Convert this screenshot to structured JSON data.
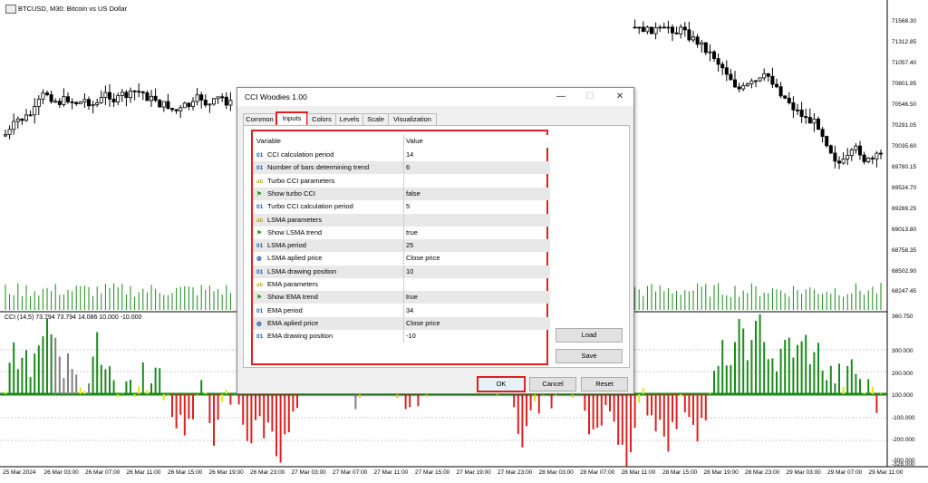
{
  "chart": {
    "title": "BTCUSD, M30:  Bitcoin vs US Dollar",
    "indicator_label": "CCI (14,5) 73.794 73.794 14.086 10.000 -10.000",
    "price_labels": [
      "71568.30",
      "71312.85",
      "71057.40",
      "70801.95",
      "70546.50",
      "70291.05",
      "70035.60",
      "69780.15",
      "69524.70",
      "69269.25",
      "69013.80",
      "68758.35",
      "68502.90",
      "68247.45",
      "360.750",
      "300.000",
      "200.000",
      "100.000",
      "-100.000",
      "-200.000",
      "-300.000",
      "-328.000"
    ],
    "time_labels": [
      "25 Mar 2024",
      "26 Mar 03:00",
      "26 Mar 07:00",
      "26 Mar 11:00",
      "26 Mar 15:00",
      "26 Mar 19:00",
      "26 Mar 23:00",
      "27 Mar 03:00",
      "27 Mar 07:00",
      "27 Mar 11:00",
      "27 Mar 15:00",
      "27 Mar 19:00",
      "27 Mar 23:00",
      "28 Mar 03:00",
      "28 Mar 07:00",
      "28 Mar 11:00",
      "28 Mar 15:00",
      "28 Mar 19:00",
      "28 Mar 23:00",
      "29 Mar 03:00",
      "29 Mar 07:00",
      "29 Mar 11:00"
    ],
    "colors": {
      "up": "#1a8a1a",
      "down": "#e02020",
      "neutral": "#808080",
      "flat": "#e6e600"
    }
  },
  "dialog": {
    "title": "CCI Woodies 1.00",
    "minimize": "—",
    "maximize": "☐",
    "close": "✕",
    "tabs": [
      "Common",
      "Inputs",
      "Colors",
      "Levels",
      "Scale",
      "Visualization"
    ],
    "active_tab": "Inputs",
    "columns": {
      "variable": "Variable",
      "value": "Value"
    },
    "params": [
      {
        "icon": "01",
        "name": "CCI calculation period",
        "value": "14"
      },
      {
        "icon": "01",
        "name": "Number of bars determining trend",
        "value": "6"
      },
      {
        "icon": "ab",
        "name": "Turbo CCI parameters",
        "value": ""
      },
      {
        "icon": "flag",
        "name": "Show turbo CCI",
        "value": "false"
      },
      {
        "icon": "01",
        "name": "Turbo CCI calculation period",
        "value": "5"
      },
      {
        "icon": "ab",
        "name": "LSMA parameters",
        "value": ""
      },
      {
        "icon": "flag",
        "name": "Show LSMA trend",
        "value": "true"
      },
      {
        "icon": "01",
        "name": "LSMA period",
        "value": "25"
      },
      {
        "icon": "globe",
        "name": "LSMA aplied price",
        "value": "Close price"
      },
      {
        "icon": "01",
        "name": "LSMA drawing position",
        "value": "10"
      },
      {
        "icon": "ab",
        "name": "EMA parameters",
        "value": ""
      },
      {
        "icon": "flag",
        "name": "Show EMA trend",
        "value": "true"
      },
      {
        "icon": "01",
        "name": "EMA period",
        "value": "34"
      },
      {
        "icon": "globe",
        "name": "EMA aplied price",
        "value": "Close price"
      },
      {
        "icon": "01",
        "name": "EMA drawing position",
        "value": "-10"
      }
    ],
    "buttons": {
      "load": "Load",
      "save": "Save",
      "ok": "OK",
      "cancel": "Cancel",
      "reset": "Reset"
    }
  }
}
